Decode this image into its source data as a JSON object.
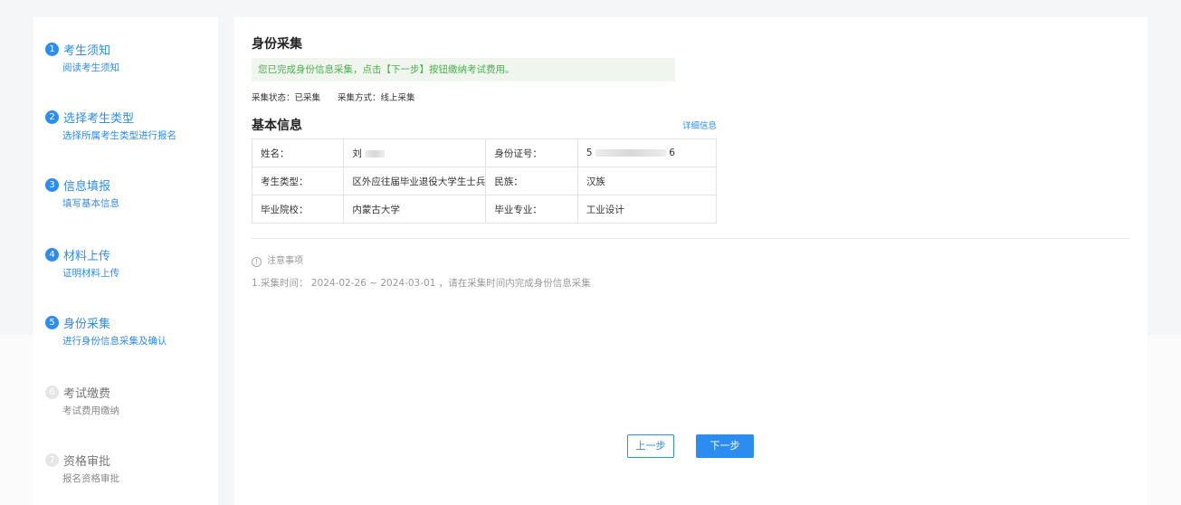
{
  "steps": [
    {
      "num": "1",
      "title": "考生须知",
      "sub": "阅读考生须知"
    },
    {
      "num": "2",
      "title": "选择考生类型",
      "sub": "选择所属考生类型进行报名"
    },
    {
      "num": "3",
      "title": "信息填报",
      "sub": "填写基本信息"
    },
    {
      "num": "4",
      "title": "材料上传",
      "sub": "证明材料上传"
    },
    {
      "num": "5",
      "title": "身份采集",
      "sub": "进行身份信息采集及确认"
    },
    {
      "num": "6",
      "title": "考试缴费",
      "sub": "考试费用缴纳"
    },
    {
      "num": "7",
      "title": "资格审批",
      "sub": "报名资格审批"
    }
  ],
  "section": {
    "title": "身份采集",
    "notice": "您已完成身份信息采集，点击【下一步】按钮缴纳考试费用。",
    "status": "采集状态：已采集",
    "method": "采集方式：线上采集"
  },
  "basic": {
    "title": "基本信息",
    "detail_link": "详细信息",
    "rows": [
      {
        "k1": "姓名：",
        "v1": "刘",
        "k2": "身份证号：",
        "v2a": "5",
        "v2b": "6"
      },
      {
        "k1": "考生类型：",
        "v1": "区外应往届毕业退役大学生士兵",
        "k2": "民族：",
        "v2": "汉族"
      },
      {
        "k1": "毕业院校：",
        "v1": "内蒙古大学",
        "k2": "毕业专业：",
        "v2": "工业设计"
      }
    ]
  },
  "notes": {
    "icon": "info-circle-icon",
    "head": "注意事项",
    "line1": "1.采集时间： 2024-02-26 ~ 2024-03-01 ，请在采集时间内完成身份信息采集"
  },
  "buttons": {
    "prev": "上一步",
    "next": "下一步"
  },
  "colors": {
    "accent": "#2d8cf0",
    "success_text": "#4caf50",
    "notice_bg": "#f0f5ee",
    "pending": "#e6e6e6"
  }
}
